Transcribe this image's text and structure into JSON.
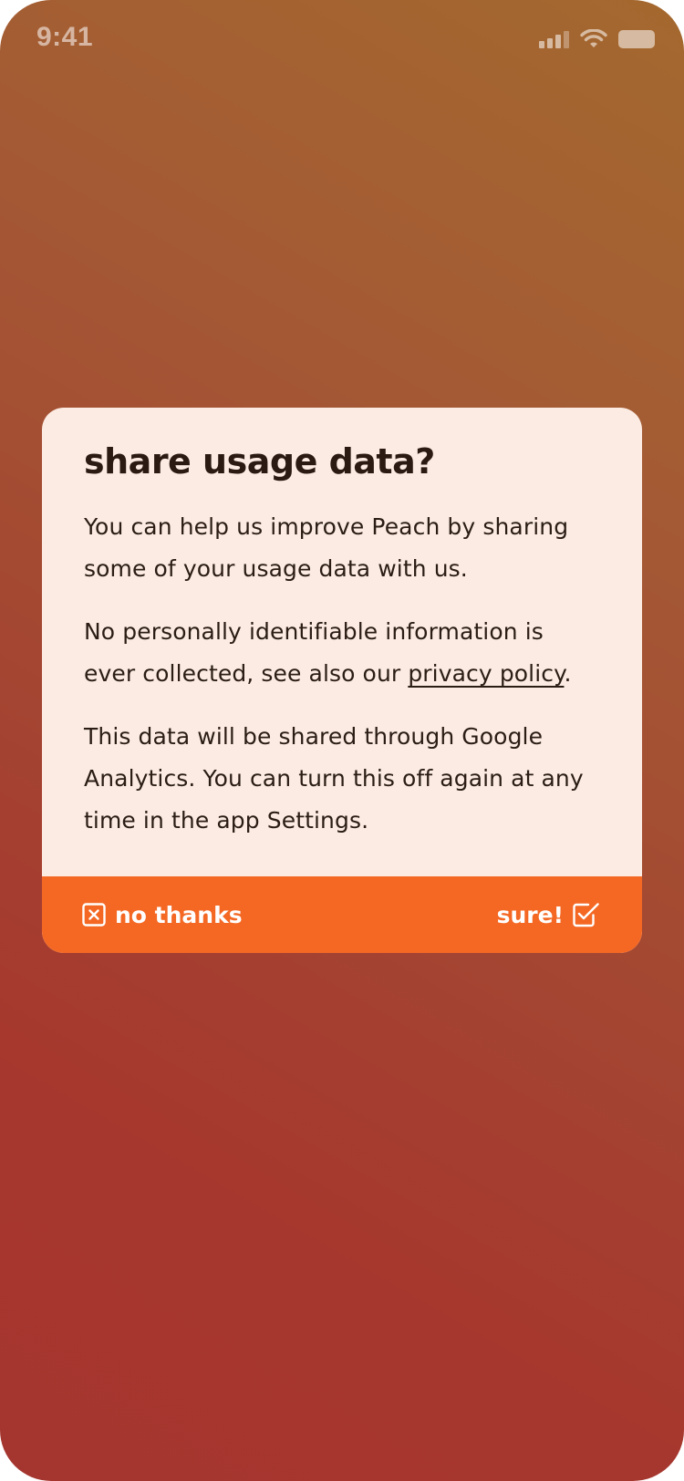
{
  "status_bar": {
    "time": "9:41",
    "icons": [
      "signal-icon",
      "wifi-icon",
      "battery-icon"
    ]
  },
  "dialog": {
    "title": "share usage data?",
    "paragraph1": "You can help us improve Peach by sharing some of your usage data with us.",
    "paragraph2_prefix": "No personally identifiable information is ever collected, see also our ",
    "privacy_link": "privacy policy",
    "paragraph2_suffix": ".",
    "paragraph3": "This data will be shared through Google Analytics. You can turn this off again at any time in the app Settings.",
    "decline_label": "no thanks",
    "decline_icon": "close-box-icon",
    "accept_label": "sure!",
    "accept_icon": "checkbox-checked-icon"
  },
  "colors": {
    "accent": "#f46824",
    "dialog_background": "#fbebe2",
    "text": "#2b1d15",
    "background_top": "#a4692f",
    "background_bottom": "#a5362f"
  }
}
